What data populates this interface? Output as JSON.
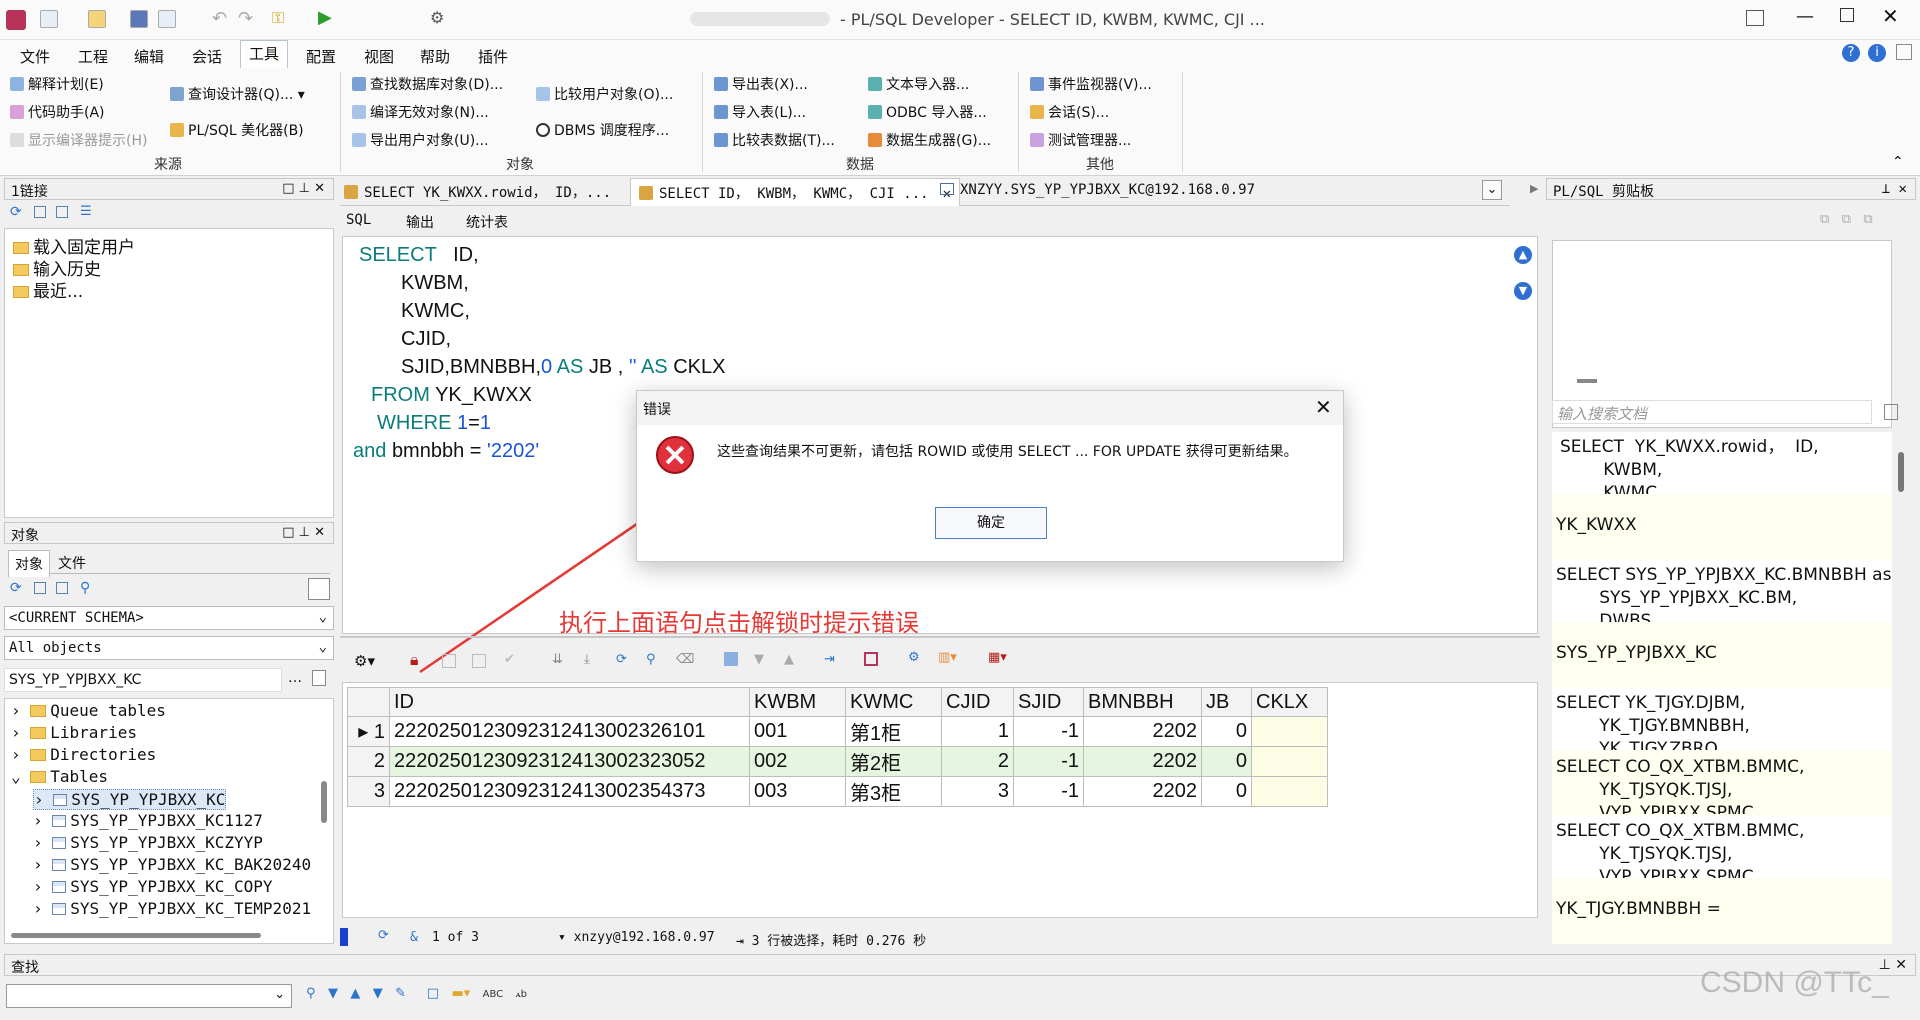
{
  "window": {
    "title": "- PL/SQL Developer - SELECT ID, KWBM, KWMC, CJI ..."
  },
  "menu": [
    "文件",
    "工程",
    "编辑",
    "会话",
    "工具",
    "配置",
    "视图",
    "帮助",
    "插件"
  ],
  "ribbon": {
    "source": {
      "items": [
        "解释计划(E)",
        "代码助手(A)",
        "显示编译器提示(H)",
        "查询设计器(Q)...",
        "PL/SQL 美化器(B)"
      ],
      "label": "来源"
    },
    "objects": {
      "items": [
        "查找数据库对象(D)...",
        "编译无效对象(N)...",
        "导出用户对象(U)...",
        "比较用户对象(O)...",
        "DBMS 调度程序..."
      ],
      "label": "对象"
    },
    "data": {
      "items": [
        "导出表(X)...",
        "导入表(L)...",
        "比较表数据(T)...",
        "文本导入器...",
        "ODBC 导入器...",
        "数据生成器(G)..."
      ],
      "label": "数据"
    },
    "other": {
      "items": [
        "事件监视器(V)...",
        "会话(S)...",
        "测试管理器..."
      ],
      "label": "其他"
    }
  },
  "connections": {
    "title": "1链接",
    "items": [
      "载入固定用户",
      "输入历史",
      "最近..."
    ]
  },
  "objects_panel": {
    "title": "对象",
    "tabs": [
      "对象",
      "文件"
    ],
    "schema": "<CURRENT SCHEMA>",
    "filter": "All objects",
    "search": "SYS_YP_YPJBXX_KC",
    "tree": [
      "Queue tables",
      "Libraries",
      "Directories",
      "Tables"
    ],
    "tables": [
      "SYS_YP_YPJBXX_KC",
      "SYS_YP_YPJBXX_KC1127",
      "SYS_YP_YPJBXX_KCZYYP",
      "SYS_YP_YPJBXX_KC_BAK20240",
      "SYS_YP_YPJBXX_KC_COPY",
      "SYS_YP_YPJBXX_KC_TEMP2021"
    ]
  },
  "doc_tabs": [
    "SELECT YK_KWXX.rowid， ID，...",
    "SELECT ID， KWBM， KWMC， CJI ...",
    "XNZYY.SYS_YP_YPJBXX_KC@192.168.0.97"
  ],
  "editor_tabs": [
    "SQL",
    "输出",
    "统计表"
  ],
  "sql": {
    "l1_kw": "SELECT",
    "l1_rest": "ID,",
    "l2": "KWBM,",
    "l3": "KWMC,",
    "l4": "CJID,",
    "l5_a": "SJID,BMNBBH,",
    "l5_num": "0",
    "l5_as": "AS",
    "l5_b": "JB ,",
    "l5_str": "''",
    "l5_as2": "AS",
    "l5_c": "CKLX",
    "l6_kw": "FROM",
    "l6_rest": "YK_KWXX",
    "l7_kw": "WHERE",
    "l7_a": "1",
    "l7_eq": "=",
    "l7_b": "1",
    "l8_kw": "and",
    "l8_rest": "bmnbbh =",
    "l8_str": "'2202'"
  },
  "dialog": {
    "title": "错误",
    "message": "这些查询结果不可更新，请包括 ROWID 或使用 SELECT ... FOR UPDATE 获得可更新结果。",
    "ok": "确定"
  },
  "annotation": "执行上面语句点击解锁时提示错误",
  "grid": {
    "columns": [
      "ID",
      "KWBM",
      "KWMC",
      "CJID",
      "SJID",
      "BMNBBH",
      "JB",
      "CKLX"
    ],
    "rows": [
      [
        "1",
        "2220250123092312413002326101",
        "001",
        "第1柜",
        "1",
        "-1",
        "2202",
        "0",
        ""
      ],
      [
        "2",
        "2220250123092312413002323052",
        "002",
        "第2柜",
        "2",
        "-1",
        "2202",
        "0",
        ""
      ],
      [
        "3",
        "2220250123092312413002354373",
        "003",
        "第3柜",
        "3",
        "-1",
        "2202",
        "0",
        ""
      ]
    ]
  },
  "statusbar": {
    "position": "1 of 3",
    "connection": "xnzyy@192.168.0.97",
    "info": "3 行被选择，耗时 0.276 秒"
  },
  "clipboard": {
    "title": "PL/SQL 剪贴板",
    "search_placeholder": "输入搜索文档",
    "items": [
      "SELECT  YK_KWXX.rowid，  ID,\n        KWBM,\n        KWMC,",
      "YK_KWXX",
      "SELECT SYS_YP_YPJBXX_KC.BMNBBH as B\n        SYS_YP_YPJBXX_KC.BM,\n        DWBS,",
      "SYS_YP_YPJBXX_KC",
      "SELECT YK_TJGY.DJBM,\n        YK_TJGY.BMNBBH,\n        YK_TJGY.ZBRQ,",
      "SELECT CO_QX_XTBM.BMMC,\n        YK_TJSYQK.TJSJ,\n        VYP_YPJBXX.SPMC,",
      "SELECT CO_QX_XTBM.BMMC,\n        YK_TJSYQK.TJSJ,\n        VYP_YPJBXX.SPMC,",
      "YK_TJGY.BMNBBH ="
    ]
  },
  "find": {
    "title": "查找"
  },
  "watermark": "CSDN @TTc_"
}
